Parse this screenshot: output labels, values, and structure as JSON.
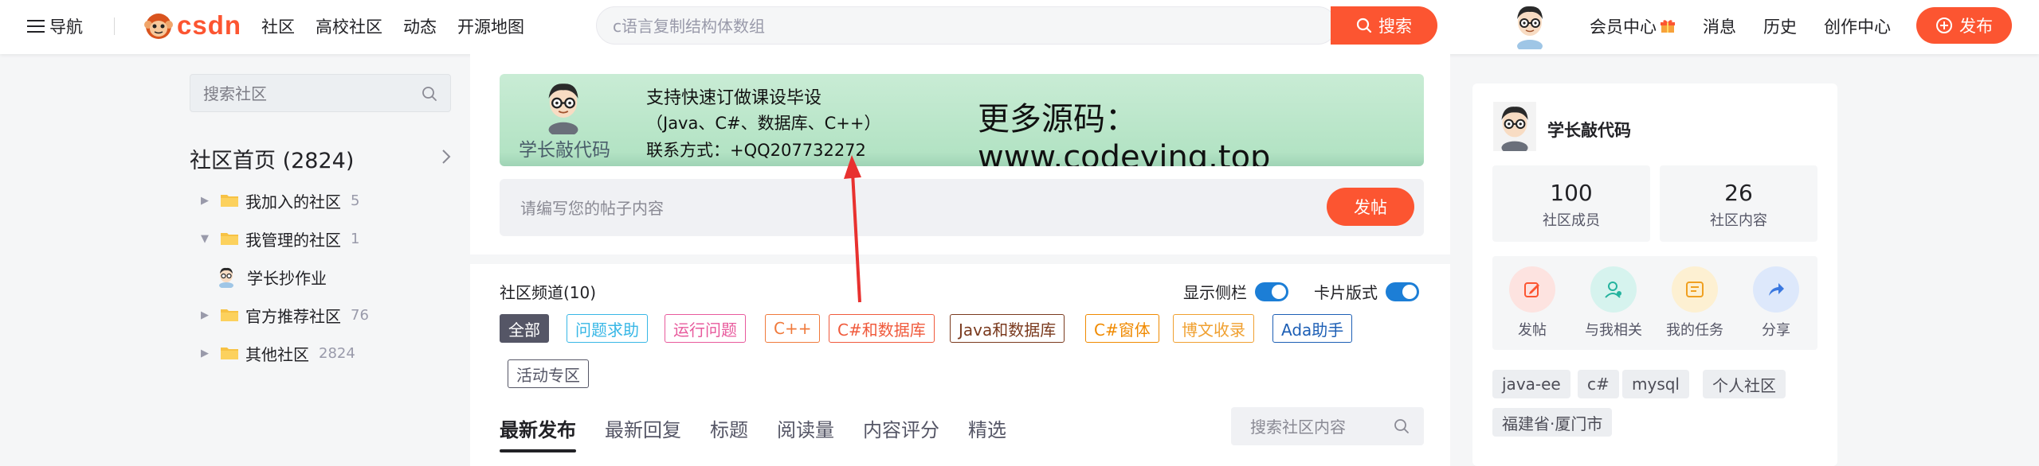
{
  "topbar": {
    "nav_label": "导航",
    "logo_text": "CSDN",
    "links": [
      "社区",
      "高校社区",
      "动态",
      "开源地图"
    ],
    "search_placeholder": "c语言复制结构体数组",
    "search_button": "搜索",
    "right_links": [
      "会员中心",
      "消息",
      "历史",
      "创作中心"
    ],
    "publish_button": "发布"
  },
  "left_sidebar": {
    "search_placeholder": "搜索社区",
    "home_label": "社区首页 (2824)",
    "tree": [
      {
        "label": "我加入的社区",
        "count": "5",
        "expanded": false
      },
      {
        "label": "我管理的社区",
        "count": "1",
        "expanded": true
      },
      {
        "label": "学长抄作业",
        "count": "",
        "child": true
      },
      {
        "label": "官方推荐社区",
        "count": "76",
        "expanded": false
      },
      {
        "label": "其他社区",
        "count": "2824",
        "expanded": false
      }
    ]
  },
  "main": {
    "banner": {
      "name": "学长敲代码",
      "line1": "支持快速订做课设毕设",
      "line2": "（Java、C#、数据库、C++）",
      "line3": "联系方式：+QQ207732272",
      "big_text": "更多源码：www.codeying.top"
    },
    "post_placeholder": "请编写您的帖子内容",
    "post_button": "发帖",
    "channel_title": "社区频道(10)",
    "toggle_sidebar_label": "显示侧栏",
    "toggle_card_label": "卡片版式",
    "tags": [
      "全部",
      "问题求助",
      "运行问题",
      "C++",
      "C#和数据库",
      "Java和数据库",
      "C#窗体",
      "博文收录",
      "Ada助手",
      "活动专区"
    ],
    "tabs": [
      "最新发布",
      "最新回复",
      "标题",
      "阅读量",
      "内容评分",
      "精选"
    ],
    "content_search_placeholder": "搜索社区内容"
  },
  "right_sidebar": {
    "name": "学长敲代码",
    "stats": [
      {
        "num": "100",
        "label": "社区成员"
      },
      {
        "num": "26",
        "label": "社区内容"
      }
    ],
    "actions": [
      "发帖",
      "与我相关",
      "我的任务",
      "分享"
    ],
    "chips": [
      "java-ee",
      "c#",
      "mysql",
      "个人社区",
      "福建省·厦门市"
    ]
  },
  "colors": {
    "accent": "#fc5531",
    "toggle": "#1c7ed6",
    "banner_green": "#b3e3c4",
    "annotation_arrow": "#e8312f"
  }
}
